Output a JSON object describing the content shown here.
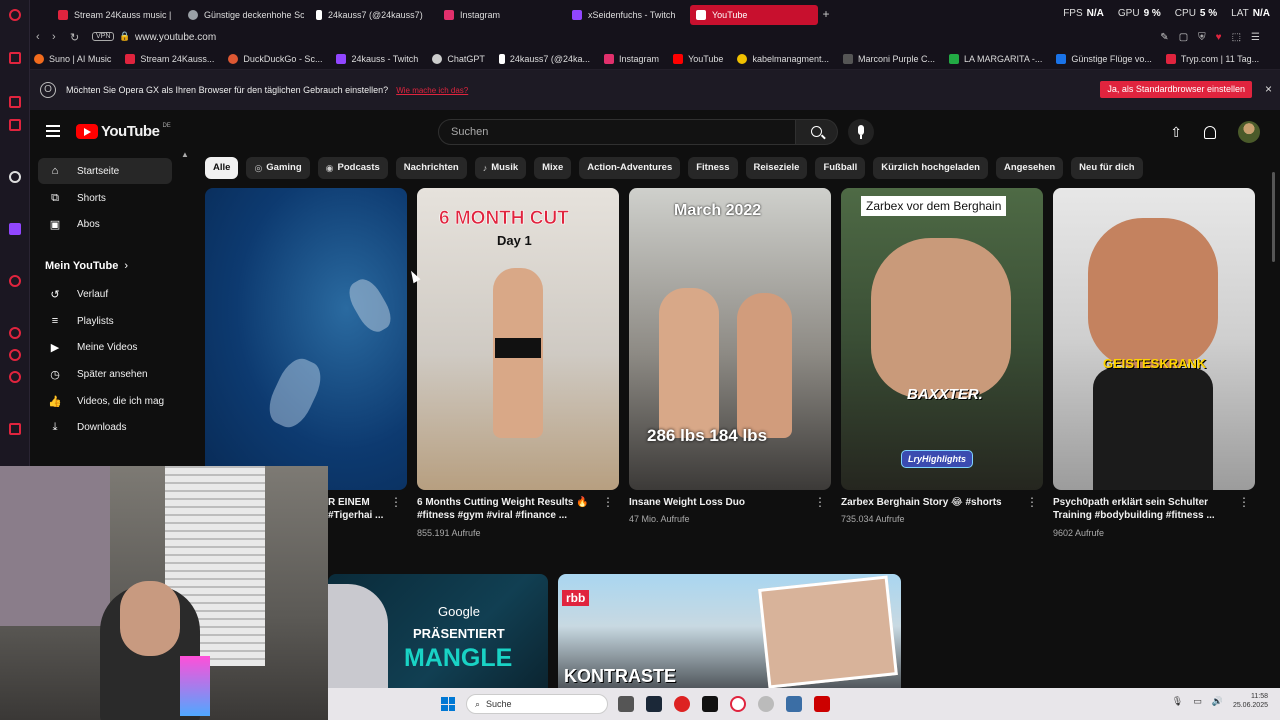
{
  "tabs": [
    {
      "label": "Stream 24Kauss music |",
      "color": "#e0243e"
    },
    {
      "label": "Günstige deckenhohe Sc",
      "color": "#9aa0a6"
    },
    {
      "label": "24kauss7 (@24kauss7)",
      "color": "#ffffff"
    },
    {
      "label": "Instagram",
      "color": "#e1306c"
    },
    {
      "label": "xSeidenfuchs - Twitch",
      "color": "#9146ff"
    },
    {
      "label": "YouTube",
      "color": "#ff0000"
    }
  ],
  "stats": {
    "fps_label": "FPS",
    "fps_value": "N/A",
    "gpu_label": "GPU",
    "gpu_value": "9 %",
    "cpu_label": "CPU",
    "cpu_value": "5 %",
    "lat_label": "LAT",
    "lat_value": "N/A"
  },
  "address": {
    "vpn": "VPN",
    "url": "www.youtube.com"
  },
  "bookmarks": [
    {
      "label": "Suno | AI Music",
      "color": "#f26b1d"
    },
    {
      "label": "Stream 24Kauss...",
      "color": "#e0243e"
    },
    {
      "label": "DuckDuckGo - Sc...",
      "color": "#de5833"
    },
    {
      "label": "24kauss - Twitch",
      "color": "#9146ff"
    },
    {
      "label": "ChatGPT",
      "color": "#cccccc"
    },
    {
      "label": "24kauss7 (@24ka...",
      "color": "#ffffff"
    },
    {
      "label": "Instagram",
      "color": "#e1306c"
    },
    {
      "label": "YouTube",
      "color": "#ff0000"
    },
    {
      "label": "kabelmanagment...",
      "color": "#f0c000"
    },
    {
      "label": "Marconi Purple C...",
      "color": "#555555"
    },
    {
      "label": "LA MARGARITA -...",
      "color": "#22aa44"
    },
    {
      "label": "Günstige Flüge vo...",
      "color": "#1a73e8"
    },
    {
      "label": "Tryp.com | 11 Tag...",
      "color": "#e0243e"
    }
  ],
  "notice": {
    "text": "Möchten Sie Opera GX als Ihren Browser für den täglichen Gebrauch einstellen?",
    "link": "Wie mache ich das?",
    "button": "Ja, als Standardbrowser einstellen",
    "close": "×"
  },
  "youtube": {
    "logo_text": "YouTube",
    "country": "DE",
    "search_placeholder": "Suchen"
  },
  "sidebar": {
    "items": [
      {
        "label": "Startseite"
      },
      {
        "label": "Shorts"
      },
      {
        "label": "Abos"
      }
    ],
    "section_title": "Mein YouTube",
    "section_items": [
      {
        "label": "Verlauf"
      },
      {
        "label": "Playlists"
      },
      {
        "label": "Meine Videos"
      },
      {
        "label": "Später ansehen"
      },
      {
        "label": "Videos, die ich mag"
      },
      {
        "label": "Downloads"
      }
    ]
  },
  "chips": [
    "Alle",
    "Gaming",
    "Podcasts",
    "Nachrichten",
    "Musik",
    "Mixe",
    "Action-Adventures",
    "Fitness",
    "Reiseziele",
    "Fußball",
    "Kürzlich hochgeladen",
    "Angesehen",
    "Neu für dich"
  ],
  "shorts": [
    {
      "title_line1": "R EINEM",
      "title_line2": "#Tigerhai ...",
      "views": ""
    },
    {
      "title_line1": "6 Months Cutting Weight Results 🔥",
      "title_line2": "#fitness #gym #viral #finance ...",
      "views": "855.191 Aufrufe",
      "overlay1": "6 MONTH CUT",
      "overlay2": "Day 1"
    },
    {
      "title_line1": "Insane Weight Loss Duo",
      "title_line2": "",
      "views": "47 Mio. Aufrufe",
      "overlay1": "March 2022",
      "overlay2": "286 lbs  184 lbs"
    },
    {
      "title_line1": "Zarbex Berghain Story 😂 #shorts",
      "title_line2": "",
      "views": "735.034 Aufrufe",
      "overlay1": "Zarbex vor dem Berghain",
      "overlay2": "BAXXTER.",
      "overlay3": "LryHighlights"
    },
    {
      "title_line1": "Psych0path erklärt sein Schulter",
      "title_line2": "Training #bodybuilding #fitness ...",
      "views": "9602 Aufrufe",
      "overlay1": "GEISTESKRANK"
    }
  ],
  "videos": [
    {
      "brand": "Google",
      "line1": "PRÄSENTIERT",
      "line2": "MANGLE"
    },
    {
      "brand": "rbb",
      "line1": "KONTRASTE"
    }
  ],
  "taskbar": {
    "search": "Suche",
    "time": "11:58",
    "date": "25.06.2025"
  }
}
